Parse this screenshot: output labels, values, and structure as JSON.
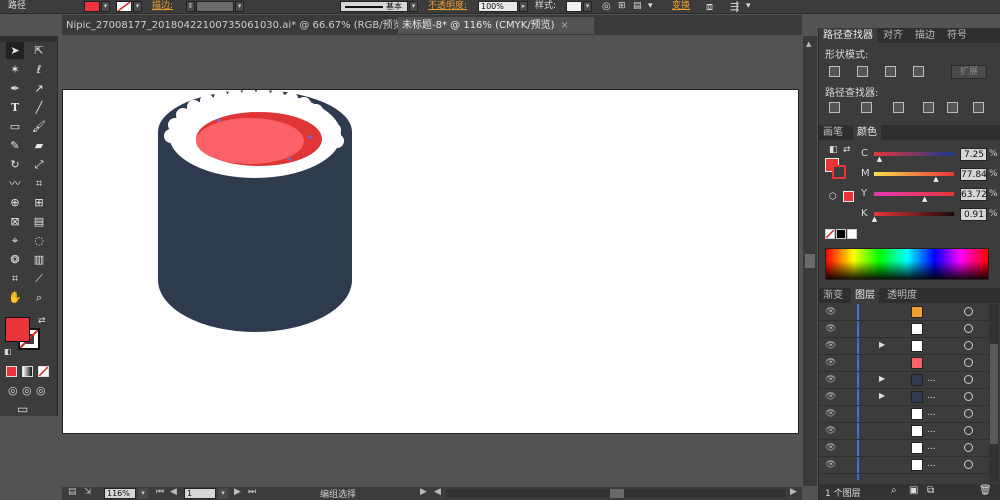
{
  "control_bar": {
    "selection_label": "路径",
    "stroke_label": "描边:",
    "brush_label": "基本",
    "opacity_label": "不透明度:",
    "opacity_value": "100%",
    "style_label": "样式:",
    "transform_label": "变换",
    "fill_color": "#e8343a"
  },
  "tabs": [
    {
      "label": "Nipic_27008177_20180422100735061030.ai* @ 66.67% (RGB/预览)",
      "close": "×",
      "active": false
    },
    {
      "label": "未标题-8* @ 116% (CMYK/预览)",
      "close": "×",
      "active": true
    }
  ],
  "tools": {
    "fill_color": "#e8343a",
    "stroke_color": "#e8343a"
  },
  "artwork": {
    "roll_color": "#2e3a4e",
    "rice_color": "#ffffff",
    "fish_dark": "#e03535",
    "fish_light": "#fb6167",
    "anchor_color": "#6a6cd6"
  },
  "pathfinder": {
    "tabs": [
      "路径查找器",
      "对齐",
      "描边",
      "符号"
    ],
    "shape_modes_label": "形状模式:",
    "expand_label": "扩展",
    "pathfinders_label": "路径查找器:"
  },
  "color_panel": {
    "tabs": [
      "画笔",
      "颜色"
    ],
    "channels": [
      {
        "name": "C",
        "value": "7.25",
        "unit": "%",
        "level": 0.0725,
        "gradient": "linear-gradient(90deg,#e8343a,#153a8a)"
      },
      {
        "name": "M",
        "value": "77.84",
        "unit": "%",
        "level": 0.7784,
        "gradient": "linear-gradient(90deg,#f5e14a,#e8343a)"
      },
      {
        "name": "Y",
        "value": "63.72",
        "unit": "%",
        "level": 0.6372,
        "gradient": "linear-gradient(90deg,#e23ab0,#e8343a)"
      },
      {
        "name": "K",
        "value": "0.91",
        "unit": "%",
        "level": 0.0091,
        "gradient": "linear-gradient(90deg,#e8343a,#1a0a0a)"
      }
    ],
    "current_color": "#e8343a"
  },
  "layers_panel": {
    "tabs": [
      "渐变",
      "图层",
      "透明度"
    ],
    "footer_label": "1 个图层",
    "rows": [
      {
        "thumb": "#f0a030",
        "expand": false,
        "name": ""
      },
      {
        "thumb": "#ffffff",
        "expand": false,
        "name": ""
      },
      {
        "thumb": "#ffffff",
        "expand": true,
        "name": ""
      },
      {
        "thumb": "#fb6167",
        "expand": false,
        "name": ""
      },
      {
        "thumb": "#2e3a4e",
        "expand": true,
        "name": "..."
      },
      {
        "thumb": "#2e3a4e",
        "expand": true,
        "name": "..."
      },
      {
        "thumb": "#ffffff",
        "expand": false,
        "name": "..."
      },
      {
        "thumb": "#ffffff",
        "expand": false,
        "name": "..."
      },
      {
        "thumb": "#ffffff",
        "expand": false,
        "name": "..."
      },
      {
        "thumb": "#ffffff",
        "expand": false,
        "name": "..."
      }
    ]
  },
  "status_bar": {
    "zoom_value": "116%",
    "page_value": "1",
    "mode_label": "编组选择"
  }
}
